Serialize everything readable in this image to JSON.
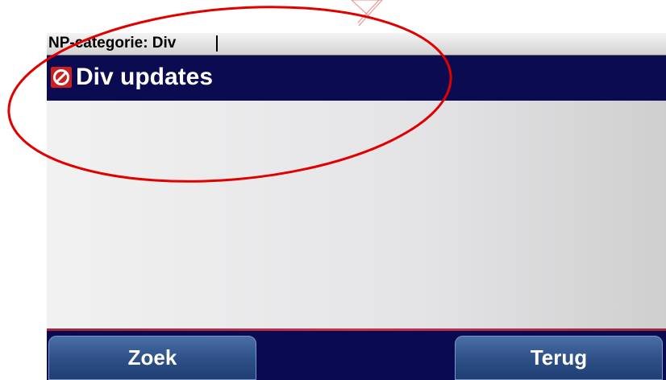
{
  "search": {
    "text": "NP-categorie: Div"
  },
  "results": [
    {
      "label": "Div updates",
      "icon": "no-entry-icon",
      "selected": true
    }
  ],
  "buttons": {
    "search_label": "Zoek",
    "back_label": "Terug"
  },
  "colors": {
    "background": "#0a0a52",
    "selection": "#0b0b52",
    "button": "#2d4f86",
    "icon": "#cc1f1f",
    "annotation": "#e00000"
  }
}
